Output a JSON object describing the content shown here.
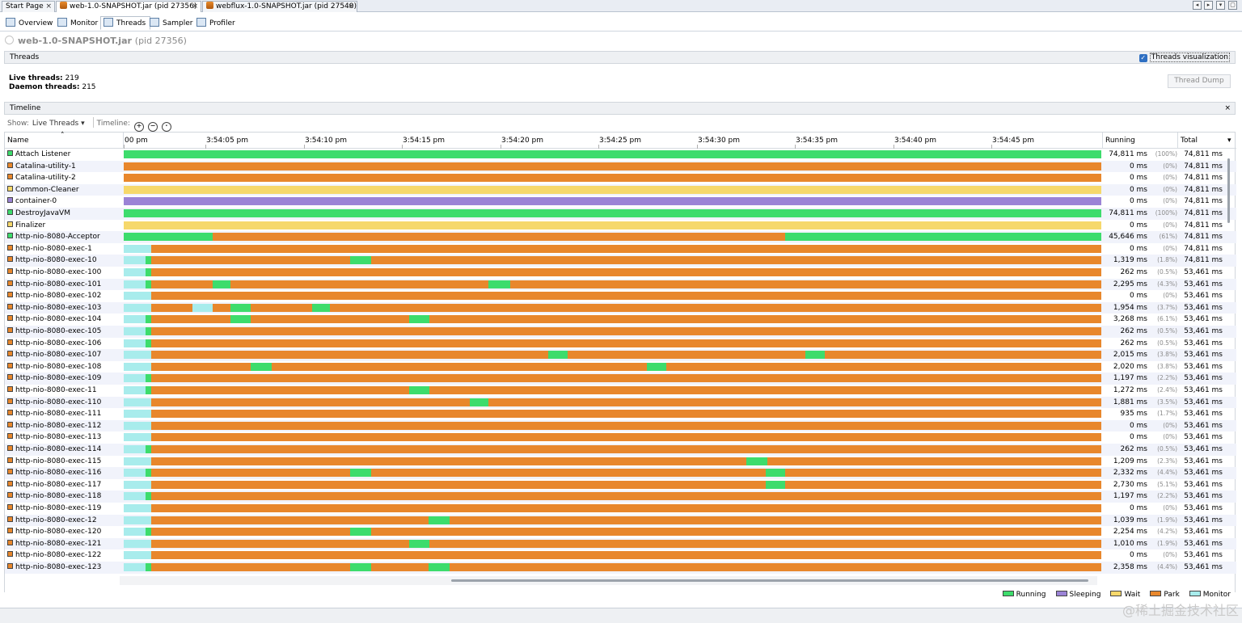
{
  "doc_tabs": [
    {
      "label": "Start Page",
      "close": "×",
      "has_icon": false,
      "active": false
    },
    {
      "label": "web-1.0-SNAPSHOT.jar (pid 27356)",
      "close": "×",
      "has_icon": true,
      "active": true
    },
    {
      "label": "webflux-1.0-SNAPSHOT.jar (pid 27540)",
      "close": "×",
      "has_icon": true,
      "active": false
    }
  ],
  "sub_tabs": [
    "Overview",
    "Monitor",
    "Threads",
    "Sampler",
    "Profiler"
  ],
  "active_sub_tab": "Threads",
  "app": {
    "name": "web-1.0-SNAPSHOT.jar",
    "pid": "(pid 27356)"
  },
  "threads_section": {
    "title": "Threads",
    "visualization_label": "Threads visualization",
    "visualization_checked": true
  },
  "stats": {
    "live_label": "Live threads:",
    "live_value": "219",
    "daemon_label": "Daemon threads:",
    "daemon_value": "215"
  },
  "thread_dump_label": "Thread Dump",
  "timeline_section": {
    "title": "Timeline",
    "close": "×"
  },
  "toolbar": {
    "show_label": "Show:",
    "show_value": "Live Threads",
    "timeline_label": "Timeline:"
  },
  "columns": {
    "name": "Name",
    "running": "Running",
    "total": "Total"
  },
  "time_ticks": [
    "00 pm",
    "3:54:05 pm",
    "3:54:10 pm",
    "3:54:15 pm",
    "3:54:20 pm",
    "3:54:25 pm",
    "3:54:30 pm",
    "3:54:35 pm",
    "3:54:40 pm",
    "3:54:45 pm"
  ],
  "timeline_seconds": 49.7,
  "state_colors": {
    "Running": "#3ddc6c",
    "Sleeping": "#9b83d6",
    "Wait": "#f6d86b",
    "Park": "#e8872c",
    "Monitor": "#a8ecec"
  },
  "legend": [
    "Running",
    "Sleeping",
    "Wait",
    "Park",
    "Monitor"
  ],
  "threads": [
    {
      "name": "Attach Listener",
      "state": "Running",
      "running_ms": "74,811 ms",
      "running_pct": "(100%)",
      "total_ms": "74,811 ms",
      "segments": [
        [
          "Running",
          0,
          1
        ]
      ]
    },
    {
      "name": "Catalina-utility-1",
      "state": "Park",
      "running_ms": "0 ms",
      "running_pct": "(0%)",
      "total_ms": "74,811 ms",
      "segments": [
        [
          "Park",
          0,
          1
        ]
      ]
    },
    {
      "name": "Catalina-utility-2",
      "state": "Park",
      "running_ms": "0 ms",
      "running_pct": "(0%)",
      "total_ms": "74,811 ms",
      "segments": [
        [
          "Park",
          0,
          1
        ]
      ]
    },
    {
      "name": "Common-Cleaner",
      "state": "Wait",
      "running_ms": "0 ms",
      "running_pct": "(0%)",
      "total_ms": "74,811 ms",
      "segments": [
        [
          "Wait",
          0,
          1
        ]
      ]
    },
    {
      "name": "container-0",
      "state": "Sleeping",
      "running_ms": "0 ms",
      "running_pct": "(0%)",
      "total_ms": "74,811 ms",
      "segments": [
        [
          "Sleeping",
          0,
          1
        ]
      ]
    },
    {
      "name": "DestroyJavaVM",
      "state": "Running",
      "running_ms": "74,811 ms",
      "running_pct": "(100%)",
      "total_ms": "74,811 ms",
      "segments": [
        [
          "Running",
          0,
          1
        ]
      ]
    },
    {
      "name": "Finalizer",
      "state": "Wait",
      "running_ms": "0 ms",
      "running_pct": "(0%)",
      "total_ms": "74,811 ms",
      "segments": [
        [
          "Wait",
          0,
          1
        ]
      ]
    },
    {
      "name": "http-nio-8080-Acceptor",
      "state": "Running",
      "running_ms": "45,646 ms",
      "running_pct": "(61%)",
      "total_ms": "74,811 ms",
      "segments": [
        [
          "Running",
          0,
          0.091
        ],
        [
          "Park",
          0.091,
          0.677
        ],
        [
          "Running",
          0.677,
          1
        ]
      ]
    },
    {
      "name": "http-nio-8080-exec-1",
      "state": "Park",
      "running_ms": "0 ms",
      "running_pct": "(0%)",
      "total_ms": "74,811 ms",
      "segments": [
        [
          "Monitor",
          0,
          0.028
        ],
        [
          "Park",
          0.028,
          1
        ]
      ]
    },
    {
      "name": "http-nio-8080-exec-10",
      "state": "Park",
      "running_ms": "1,319 ms",
      "running_pct": "(1.8%)",
      "total_ms": "74,811 ms",
      "segments": [
        [
          "Monitor",
          0,
          0.022
        ],
        [
          "Running",
          0.022,
          0.028
        ],
        [
          "Park",
          0.028,
          0.232
        ],
        [
          "Running",
          0.232,
          0.253
        ],
        [
          "Park",
          0.253,
          1
        ]
      ]
    },
    {
      "name": "http-nio-8080-exec-100",
      "state": "Park",
      "running_ms": "262 ms",
      "running_pct": "(0.5%)",
      "total_ms": "53,461 ms",
      "segments": [
        [
          "Monitor",
          0,
          0.022
        ],
        [
          "Running",
          0.022,
          0.028
        ],
        [
          "Park",
          0.028,
          1
        ]
      ]
    },
    {
      "name": "http-nio-8080-exec-101",
      "state": "Park",
      "running_ms": "2,295 ms",
      "running_pct": "(4.3%)",
      "total_ms": "53,461 ms",
      "segments": [
        [
          "Monitor",
          0,
          0.022
        ],
        [
          "Running",
          0.022,
          0.028
        ],
        [
          "Park",
          0.028,
          0.091
        ],
        [
          "Running",
          0.091,
          0.109
        ],
        [
          "Park",
          0.109,
          0.373
        ],
        [
          "Running",
          0.373,
          0.395
        ],
        [
          "Park",
          0.395,
          1
        ]
      ]
    },
    {
      "name": "http-nio-8080-exec-102",
      "state": "Park",
      "running_ms": "0 ms",
      "running_pct": "(0%)",
      "total_ms": "53,461 ms",
      "segments": [
        [
          "Monitor",
          0,
          0.028
        ],
        [
          "Park",
          0.028,
          1
        ]
      ]
    },
    {
      "name": "http-nio-8080-exec-103",
      "state": "Park",
      "running_ms": "1,954 ms",
      "running_pct": "(3.7%)",
      "total_ms": "53,461 ms",
      "segments": [
        [
          "Monitor",
          0,
          0.028
        ],
        [
          "Park",
          0.028,
          0.07
        ],
        [
          "Monitor",
          0.07,
          0.091
        ],
        [
          "Park",
          0.091,
          0.109
        ],
        [
          "Running",
          0.109,
          0.13
        ],
        [
          "Park",
          0.13,
          0.193
        ],
        [
          "Running",
          0.193,
          0.211
        ],
        [
          "Park",
          0.211,
          1
        ]
      ]
    },
    {
      "name": "http-nio-8080-exec-104",
      "state": "Park",
      "running_ms": "3,268 ms",
      "running_pct": "(6.1%)",
      "total_ms": "53,461 ms",
      "segments": [
        [
          "Monitor",
          0,
          0.022
        ],
        [
          "Running",
          0.022,
          0.028
        ],
        [
          "Park",
          0.028,
          0.109
        ],
        [
          "Running",
          0.109,
          0.13
        ],
        [
          "Park",
          0.13,
          0.292
        ],
        [
          "Running",
          0.292,
          0.313
        ],
        [
          "Park",
          0.313,
          1
        ]
      ]
    },
    {
      "name": "http-nio-8080-exec-105",
      "state": "Park",
      "running_ms": "262 ms",
      "running_pct": "(0.5%)",
      "total_ms": "53,461 ms",
      "segments": [
        [
          "Monitor",
          0,
          0.022
        ],
        [
          "Running",
          0.022,
          0.028
        ],
        [
          "Park",
          0.028,
          1
        ]
      ]
    },
    {
      "name": "http-nio-8080-exec-106",
      "state": "Park",
      "running_ms": "262 ms",
      "running_pct": "(0.5%)",
      "total_ms": "53,461 ms",
      "segments": [
        [
          "Monitor",
          0,
          0.022
        ],
        [
          "Running",
          0.022,
          0.028
        ],
        [
          "Park",
          0.028,
          1
        ]
      ]
    },
    {
      "name": "http-nio-8080-exec-107",
      "state": "Park",
      "running_ms": "2,015 ms",
      "running_pct": "(3.8%)",
      "total_ms": "53,461 ms",
      "segments": [
        [
          "Monitor",
          0,
          0.028
        ],
        [
          "Park",
          0.028,
          0.434
        ],
        [
          "Running",
          0.434,
          0.454
        ],
        [
          "Park",
          0.454,
          0.697
        ],
        [
          "Running",
          0.697,
          0.717
        ],
        [
          "Park",
          0.717,
          1
        ]
      ]
    },
    {
      "name": "http-nio-8080-exec-108",
      "state": "Park",
      "running_ms": "2,020 ms",
      "running_pct": "(3.8%)",
      "total_ms": "53,461 ms",
      "segments": [
        [
          "Monitor",
          0,
          0.028
        ],
        [
          "Park",
          0.028,
          0.13
        ],
        [
          "Running",
          0.13,
          0.151
        ],
        [
          "Park",
          0.151,
          0.535
        ],
        [
          "Running",
          0.535,
          0.555
        ],
        [
          "Park",
          0.555,
          1
        ]
      ]
    },
    {
      "name": "http-nio-8080-exec-109",
      "state": "Park",
      "running_ms": "1,197 ms",
      "running_pct": "(2.2%)",
      "total_ms": "53,461 ms",
      "segments": [
        [
          "Monitor",
          0,
          0.022
        ],
        [
          "Running",
          0.022,
          0.028
        ],
        [
          "Park",
          0.028,
          1
        ]
      ]
    },
    {
      "name": "http-nio-8080-exec-11",
      "state": "Park",
      "running_ms": "1,272 ms",
      "running_pct": "(2.4%)",
      "total_ms": "53,461 ms",
      "segments": [
        [
          "Monitor",
          0,
          0.022
        ],
        [
          "Running",
          0.022,
          0.028
        ],
        [
          "Park",
          0.028,
          0.292
        ],
        [
          "Running",
          0.292,
          0.313
        ],
        [
          "Park",
          0.313,
          1
        ]
      ]
    },
    {
      "name": "http-nio-8080-exec-110",
      "state": "Park",
      "running_ms": "1,881 ms",
      "running_pct": "(3.5%)",
      "total_ms": "53,461 ms",
      "segments": [
        [
          "Monitor",
          0,
          0.028
        ],
        [
          "Park",
          0.028,
          0.354
        ],
        [
          "Running",
          0.354,
          0.373
        ],
        [
          "Park",
          0.373,
          1
        ]
      ]
    },
    {
      "name": "http-nio-8080-exec-111",
      "state": "Park",
      "running_ms": "935 ms",
      "running_pct": "(1.7%)",
      "total_ms": "53,461 ms",
      "segments": [
        [
          "Monitor",
          0,
          0.028
        ],
        [
          "Park",
          0.028,
          1
        ]
      ]
    },
    {
      "name": "http-nio-8080-exec-112",
      "state": "Park",
      "running_ms": "0 ms",
      "running_pct": "(0%)",
      "total_ms": "53,461 ms",
      "segments": [
        [
          "Monitor",
          0,
          0.028
        ],
        [
          "Park",
          0.028,
          1
        ]
      ]
    },
    {
      "name": "http-nio-8080-exec-113",
      "state": "Park",
      "running_ms": "0 ms",
      "running_pct": "(0%)",
      "total_ms": "53,461 ms",
      "segments": [
        [
          "Monitor",
          0,
          0.028
        ],
        [
          "Park",
          0.028,
          1
        ]
      ]
    },
    {
      "name": "http-nio-8080-exec-114",
      "state": "Park",
      "running_ms": "262 ms",
      "running_pct": "(0.5%)",
      "total_ms": "53,461 ms",
      "segments": [
        [
          "Monitor",
          0,
          0.022
        ],
        [
          "Running",
          0.022,
          0.028
        ],
        [
          "Park",
          0.028,
          1
        ]
      ]
    },
    {
      "name": "http-nio-8080-exec-115",
      "state": "Park",
      "running_ms": "1,209 ms",
      "running_pct": "(2.3%)",
      "total_ms": "53,461 ms",
      "segments": [
        [
          "Monitor",
          0,
          0.028
        ],
        [
          "Park",
          0.028,
          0.637
        ],
        [
          "Running",
          0.637,
          0.658
        ],
        [
          "Park",
          0.658,
          1
        ]
      ]
    },
    {
      "name": "http-nio-8080-exec-116",
      "state": "Park",
      "running_ms": "2,332 ms",
      "running_pct": "(4.4%)",
      "total_ms": "53,461 ms",
      "segments": [
        [
          "Monitor",
          0,
          0.022
        ],
        [
          "Running",
          0.022,
          0.028
        ],
        [
          "Park",
          0.028,
          0.232
        ],
        [
          "Running",
          0.232,
          0.253
        ],
        [
          "Park",
          0.253,
          0.657
        ],
        [
          "Running",
          0.657,
          0.677
        ],
        [
          "Park",
          0.677,
          1
        ]
      ]
    },
    {
      "name": "http-nio-8080-exec-117",
      "state": "Park",
      "running_ms": "2,730 ms",
      "running_pct": "(5.1%)",
      "total_ms": "53,461 ms",
      "segments": [
        [
          "Monitor",
          0,
          0.028
        ],
        [
          "Park",
          0.028,
          0.657
        ],
        [
          "Running",
          0.657,
          0.677
        ],
        [
          "Park",
          0.677,
          1
        ]
      ]
    },
    {
      "name": "http-nio-8080-exec-118",
      "state": "Park",
      "running_ms": "1,197 ms",
      "running_pct": "(2.2%)",
      "total_ms": "53,461 ms",
      "segments": [
        [
          "Monitor",
          0,
          0.022
        ],
        [
          "Running",
          0.022,
          0.028
        ],
        [
          "Park",
          0.028,
          1
        ]
      ]
    },
    {
      "name": "http-nio-8080-exec-119",
      "state": "Park",
      "running_ms": "0 ms",
      "running_pct": "(0%)",
      "total_ms": "53,461 ms",
      "segments": [
        [
          "Monitor",
          0,
          0.028
        ],
        [
          "Park",
          0.028,
          1
        ]
      ]
    },
    {
      "name": "http-nio-8080-exec-12",
      "state": "Park",
      "running_ms": "1,039 ms",
      "running_pct": "(1.9%)",
      "total_ms": "53,461 ms",
      "segments": [
        [
          "Monitor",
          0,
          0.028
        ],
        [
          "Park",
          0.028,
          0.312
        ],
        [
          "Running",
          0.312,
          0.333
        ],
        [
          "Park",
          0.333,
          1
        ]
      ]
    },
    {
      "name": "http-nio-8080-exec-120",
      "state": "Park",
      "running_ms": "2,254 ms",
      "running_pct": "(4.2%)",
      "total_ms": "53,461 ms",
      "segments": [
        [
          "Monitor",
          0,
          0.022
        ],
        [
          "Running",
          0.022,
          0.028
        ],
        [
          "Park",
          0.028,
          0.232
        ],
        [
          "Running",
          0.232,
          0.253
        ],
        [
          "Park",
          0.253,
          1
        ]
      ]
    },
    {
      "name": "http-nio-8080-exec-121",
      "state": "Park",
      "running_ms": "1,010 ms",
      "running_pct": "(1.9%)",
      "total_ms": "53,461 ms",
      "segments": [
        [
          "Monitor",
          0,
          0.028
        ],
        [
          "Park",
          0.028,
          0.292
        ],
        [
          "Running",
          0.292,
          0.313
        ],
        [
          "Park",
          0.313,
          1
        ]
      ]
    },
    {
      "name": "http-nio-8080-exec-122",
      "state": "Park",
      "running_ms": "0 ms",
      "running_pct": "(0%)",
      "total_ms": "53,461 ms",
      "segments": [
        [
          "Monitor",
          0,
          0.028
        ],
        [
          "Park",
          0.028,
          1
        ]
      ]
    },
    {
      "name": "http-nio-8080-exec-123",
      "state": "Park",
      "running_ms": "2,358 ms",
      "running_pct": "(4.4%)",
      "total_ms": "53,461 ms",
      "segments": [
        [
          "Monitor",
          0,
          0.022
        ],
        [
          "Running",
          0.022,
          0.028
        ],
        [
          "Park",
          0.028,
          0.232
        ],
        [
          "Running",
          0.232,
          0.253
        ],
        [
          "Park",
          0.253,
          0.312
        ],
        [
          "Running",
          0.312,
          0.333
        ],
        [
          "Park",
          0.333,
          1
        ]
      ]
    }
  ],
  "watermark": "@稀土掘金技术社区"
}
